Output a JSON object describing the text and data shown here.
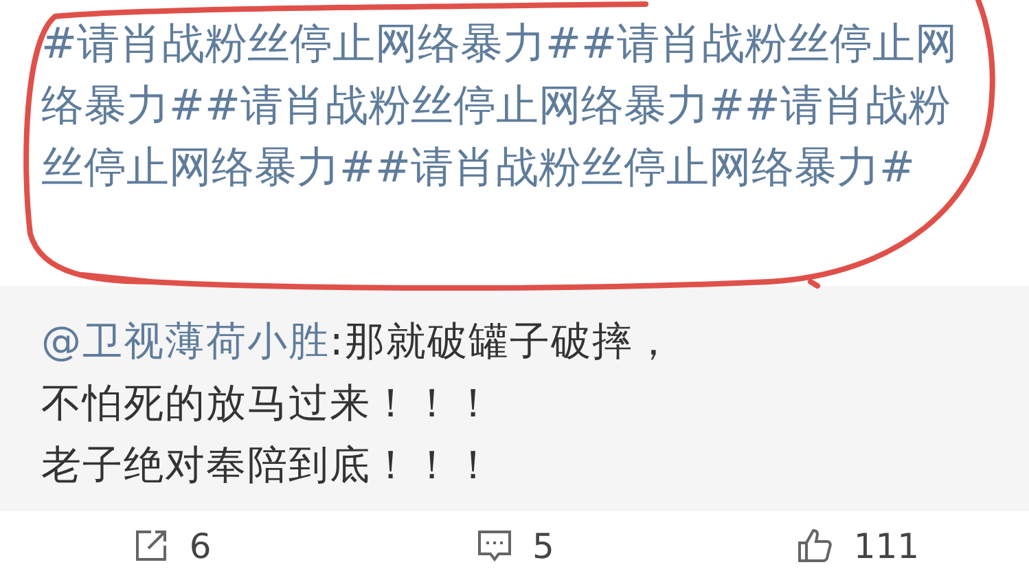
{
  "post": {
    "text": "#请肖战粉丝停止网络暴力##请肖战粉丝停止网络暴力##请肖战粉丝停止网络暴力##请肖战粉丝停止网络暴力##请肖战粉丝停止网络暴力#"
  },
  "quote": {
    "mention": "@卫视薄荷小胜",
    "text": ":那就破罐子破摔，",
    "lines": [
      "不怕死的放马过来！！！",
      "老子绝对奉陪到底！！！"
    ]
  },
  "actions": [
    {
      "kind": "repost",
      "count": "6"
    },
    {
      "kind": "comment",
      "count": "5"
    },
    {
      "kind": "like",
      "count": "111"
    }
  ]
}
